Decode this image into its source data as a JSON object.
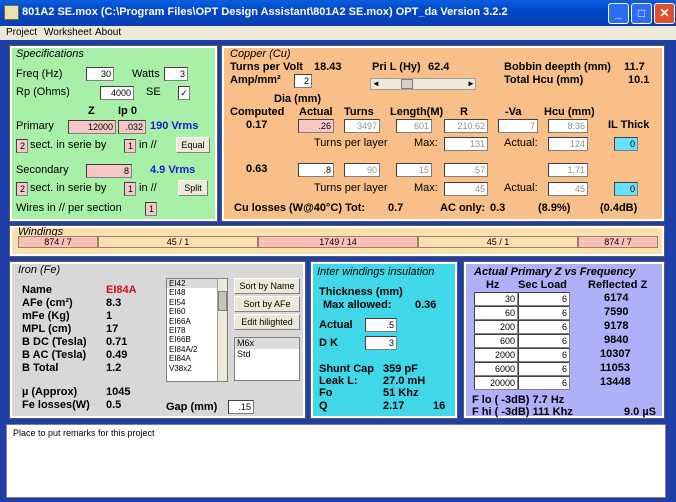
{
  "window": {
    "title": "801A2 SE.mox  (C:\\Program Files\\OPT Design Assistant\\801A2 SE.mox)  OPT_da Version 3.2.2",
    "min": "_",
    "max": "□",
    "close": "✕"
  },
  "menu": [
    "Project",
    "Worksheet",
    "About"
  ],
  "spec": {
    "title": "Specifications",
    "freq_label": "Freq (Hz)",
    "freq": "30",
    "watts_label": "Watts",
    "watts": "3",
    "rp_label": "Rp (Ohms)",
    "rp": "4000",
    "se_label": "SE",
    "se_check": "✓",
    "z_label": "Z",
    "ip0_label": "Ip 0",
    "primary_label": "Primary",
    "primary_z": "12000",
    "primary_ip0": ".032",
    "primary_vrms": "190 Vrms",
    "sect1": "2",
    "sect_text": "sect. in serie by",
    "in1": "1",
    "in_text": "in //",
    "equal_btn": "Equal",
    "secondary_label": "Secondary",
    "secondary_z": "8",
    "secondary_vrms": "4.9 Vrms",
    "sect2": "2",
    "in2": "1",
    "split_btn": "Split",
    "wires_label": "Wires in // per section",
    "wires": "1"
  },
  "copper": {
    "title": "Copper (Cu)",
    "tpv_label": "Turns per Volt",
    "tpv": "18.43",
    "pril_label": "Pri L (Hy)",
    "pril": "62.4",
    "bobbin_label": "Bobbin deepth (mm)",
    "bobbin": "11.7",
    "hcu_label": "Total Hcu (mm)",
    "hcu": "10.1",
    "amp_label": "Amp/mm²",
    "amp": "2",
    "dia_label": "Dia (mm)",
    "computed_label": "Computed",
    "actual_label": "Actual",
    "turns_label": "Turns",
    "length_label": "Length(M)",
    "r_label": "R",
    "va_label": "-Va",
    "hcuh_label": "Hcu (mm)",
    "il_label": "IL Thick",
    "row1": {
      "computed": "0.17",
      "actual": ".26",
      "turns": "3497",
      "length": "601",
      "r": "210.62",
      "va": "7",
      "hcu": "8.36",
      "il": "0",
      "tpl_label": "Turns per layer",
      "max_label": "Max:",
      "max": "131",
      "act_label": "Actual:",
      "act": "124"
    },
    "row2": {
      "computed": "0.63",
      "actual": ".8",
      "turns": "90",
      "length": "15",
      "r": ".57",
      "va": "",
      "hcu": "1.71",
      "il": "0",
      "tpl_label": "Turns per layer",
      "max_label": "Max:",
      "max": "45",
      "act_label": "Actual:",
      "act": "45"
    },
    "losses_label": "Cu losses  (W@40°C)  Tot:",
    "losses_tot": "0.7",
    "ac_label": "AC only:",
    "ac": "0.3",
    "pct": "(8.9%)",
    "db": "(0.4dB)"
  },
  "windings": {
    "title": "Windings",
    "cells": [
      "874 / 7",
      "45 / 1",
      "1749 / 14",
      "45 / 1",
      "874 / 7"
    ]
  },
  "iron": {
    "title": "Iron (Fe)",
    "name_label": "Name",
    "name": "EI84A",
    "afe_label": "AFe (cm²)",
    "afe": "8.3",
    "mfe_label": "mFe (Kg)",
    "mfe": "1",
    "mpl_label": "MPL (cm)",
    "mpl": "17",
    "bdc_label": "B DC (Tesla)",
    "bdc": "0.71",
    "bac_label": "B AC (Tesla)",
    "bac": "0.49",
    "btot_label": "B Total",
    "btot": "1.2",
    "mu_label": "µ (Approx)",
    "mu": "1045",
    "fel_label": "Fe losses(W)",
    "fel": "0.5",
    "gap_label": "Gap (mm)",
    "gap": ".15",
    "cores": [
      "EI42",
      "EI48",
      "EI54",
      "EI60",
      "EI66A",
      "EI78",
      "EI66B",
      "EI84A/2",
      "EI84A",
      "V38x2"
    ],
    "sort_name": "Sort by Name",
    "sort_afe": "Sort by AFe",
    "edit": "Edit hilighted",
    "grades": [
      "M6x",
      "Std"
    ]
  },
  "inter": {
    "title": "Inter windings insulation",
    "thick_label": "Thickness (mm)",
    "max_label": "Max allowed:",
    "max": "0.36",
    "actual_label": "Actual",
    "actual": ".5",
    "dk_label": "D K",
    "dk": "3",
    "shunt_label": "Shunt Cap",
    "shunt": "359 pF",
    "leak_label": "Leak L:",
    "leak": "27.0 mH",
    "fo_label": "Fo",
    "fo": "51 Khz",
    "q_label": "Q",
    "q": "2.17",
    "q2": "16"
  },
  "zfreq": {
    "title": "Actual Primary Z vs Frequency",
    "hz_label": "Hz",
    "load_label": "Sec Load",
    "refl_label": "Reflected Z",
    "rows": [
      {
        "hz": "30",
        "load": "6",
        "z": "6174"
      },
      {
        "hz": "60",
        "load": "6",
        "z": "7590"
      },
      {
        "hz": "200",
        "load": "6",
        "z": "9178"
      },
      {
        "hz": "600",
        "load": "6",
        "z": "9840"
      },
      {
        "hz": "2000",
        "load": "6",
        "z": "10307"
      },
      {
        "hz": "6000",
        "load": "6",
        "z": "11053"
      },
      {
        "hz": "20000",
        "load": "6",
        "z": "13448"
      }
    ],
    "flo": "F lo  ( -3dB)  7.7 Hz",
    "fhi": "F hi ( -3dB)  111 Khz",
    "us": "9.0 µS"
  },
  "remarks": "Place to put remarks for this project",
  "colors": {
    "titlebar": "#0247c8",
    "spec": "#a8f0a8",
    "copper": "#f8c088",
    "windings": "#f8e0b0",
    "iron": "#d8d8d8",
    "inter": "#40d8e8",
    "zfreq": "#b0b0f8",
    "bg": "#1e3ea8"
  }
}
